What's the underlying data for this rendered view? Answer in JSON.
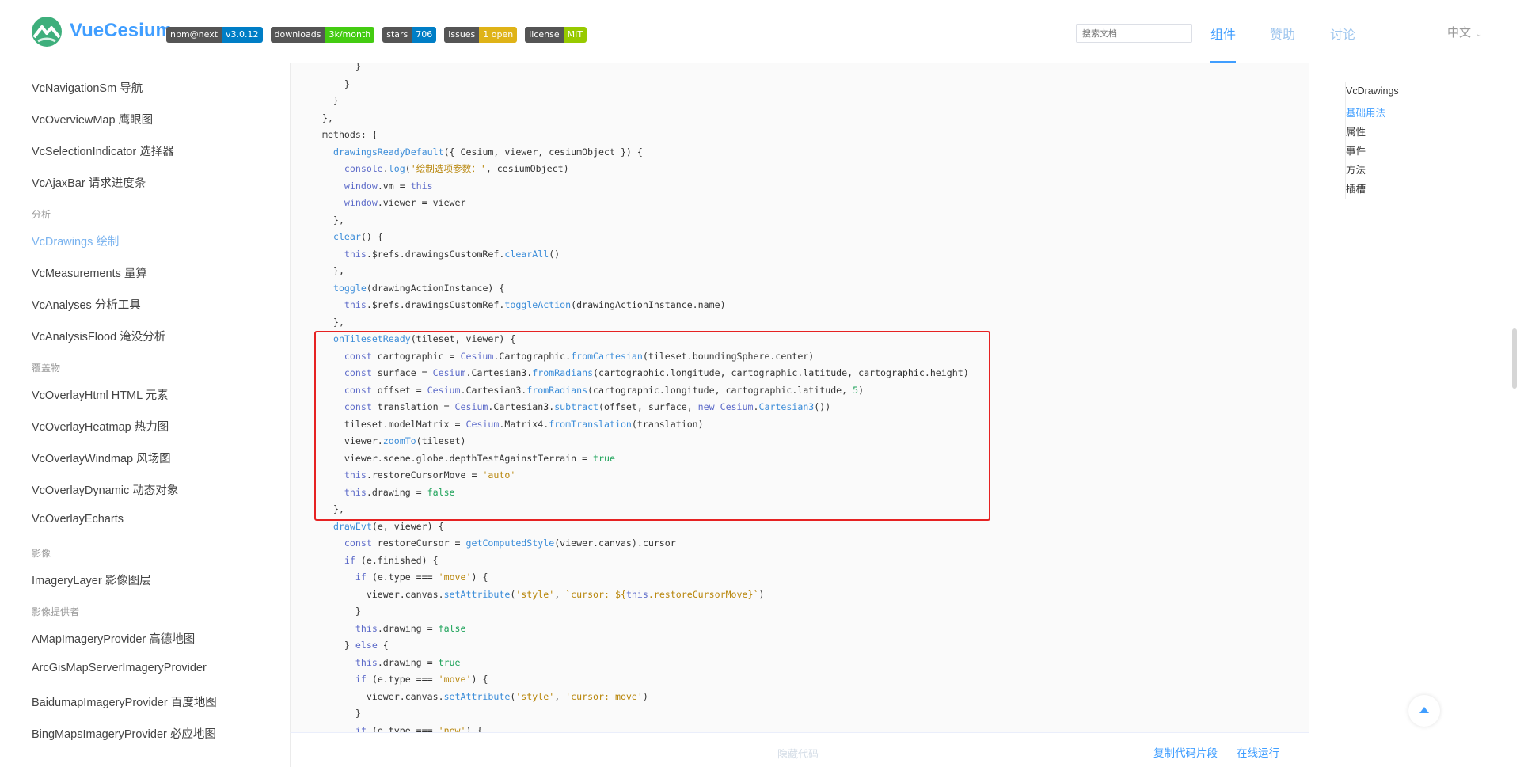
{
  "header": {
    "brand": "VueCesium",
    "badges": [
      {
        "key": "npm@next",
        "value": "v3.0.12",
        "color": "#007ec6"
      },
      {
        "key": "downloads",
        "value": "3k/month",
        "color": "#4c1"
      },
      {
        "key": "stars",
        "value": "706",
        "color": "#007ec6"
      },
      {
        "key": "issues",
        "value": "1 open",
        "color": "#dfb317"
      },
      {
        "key": "license",
        "value": "MIT",
        "color": "#97ca00"
      }
    ],
    "search_placeholder": "搜索文档",
    "nav": [
      "组件",
      "赞助",
      "讨论"
    ],
    "lang": "中文"
  },
  "sidebar": {
    "items": [
      {
        "label": "VcNavigationSm 导航",
        "type": "item"
      },
      {
        "label": "VcOverviewMap 鹰眼图",
        "type": "item"
      },
      {
        "label": "VcSelectionIndicator 选择器",
        "type": "item"
      },
      {
        "label": "VcAjaxBar 请求进度条",
        "type": "item"
      },
      {
        "label": "分析",
        "type": "group"
      },
      {
        "label": "VcDrawings 绘制",
        "type": "active"
      },
      {
        "label": "VcMeasurements 量算",
        "type": "item"
      },
      {
        "label": "VcAnalyses 分析工具",
        "type": "item"
      },
      {
        "label": "VcAnalysisFlood 淹没分析",
        "type": "item"
      },
      {
        "label": "覆盖物",
        "type": "group"
      },
      {
        "label": "VcOverlayHtml HTML 元素",
        "type": "item"
      },
      {
        "label": "VcOverlayHeatmap 热力图",
        "type": "item"
      },
      {
        "label": "VcOverlayWindmap 风场图",
        "type": "item"
      },
      {
        "label": "VcOverlayDynamic 动态对象",
        "type": "item"
      },
      {
        "label": "VcOverlayEcharts",
        "type": "item"
      },
      {
        "label": "影像",
        "type": "group"
      },
      {
        "label": "ImageryLayer 影像图层",
        "type": "item"
      },
      {
        "label": "影像提供者",
        "type": "group"
      },
      {
        "label": "AMapImageryProvider 高德地图",
        "type": "item"
      },
      {
        "label": "ArcGisMapServerImageryProvider",
        "type": "item"
      },
      {
        "label": "BaidumapImageryProvider 百度地图",
        "type": "item"
      },
      {
        "label": "BingMapsImageryProvider 必应地图",
        "type": "item"
      }
    ]
  },
  "code": [
    [
      [
        "t-plain",
        "      }"
      ]
    ],
    [
      [
        "t-plain",
        "    }"
      ]
    ],
    [
      [
        "t-plain",
        "  }"
      ]
    ],
    [
      [
        "t-plain",
        "},"
      ]
    ],
    [
      [
        "t-plain",
        "methods: {"
      ]
    ],
    [
      [
        "t-plain",
        "  "
      ],
      [
        "t-fn",
        "drawingsReadyDefault"
      ],
      [
        "t-plain",
        "({ Cesium, viewer, cesiumObject }) {"
      ]
    ],
    [
      [
        "t-plain",
        "    "
      ],
      [
        "t-kw",
        "console"
      ],
      [
        "t-plain",
        "."
      ],
      [
        "t-fn",
        "log"
      ],
      [
        "t-plain",
        "("
      ],
      [
        "t-str",
        "'绘制选项参数：'"
      ],
      [
        "t-plain",
        ", cesiumObject)"
      ]
    ],
    [
      [
        "t-plain",
        "    "
      ],
      [
        "t-kw",
        "window"
      ],
      [
        "t-plain",
        ".vm = "
      ],
      [
        "t-kw",
        "this"
      ]
    ],
    [
      [
        "t-plain",
        "    "
      ],
      [
        "t-kw",
        "window"
      ],
      [
        "t-plain",
        ".viewer = viewer"
      ]
    ],
    [
      [
        "t-plain",
        "  },"
      ]
    ],
    [
      [
        "t-plain",
        "  "
      ],
      [
        "t-fn",
        "clear"
      ],
      [
        "t-plain",
        "() {"
      ]
    ],
    [
      [
        "t-plain",
        "    "
      ],
      [
        "t-kw",
        "this"
      ],
      [
        "t-plain",
        ".$refs.drawingsCustomRef."
      ],
      [
        "t-fn",
        "clearAll"
      ],
      [
        "t-plain",
        "()"
      ]
    ],
    [
      [
        "t-plain",
        "  },"
      ]
    ],
    [
      [
        "t-plain",
        "  "
      ],
      [
        "t-fn",
        "toggle"
      ],
      [
        "t-plain",
        "(drawingActionInstance) {"
      ]
    ],
    [
      [
        "t-plain",
        "    "
      ],
      [
        "t-kw",
        "this"
      ],
      [
        "t-plain",
        ".$refs.drawingsCustomRef."
      ],
      [
        "t-fn",
        "toggleAction"
      ],
      [
        "t-plain",
        "(drawingActionInstance.name)"
      ]
    ],
    [
      [
        "t-plain",
        "  },"
      ]
    ],
    [
      [
        "t-plain",
        "  "
      ],
      [
        "t-fn",
        "onTilesetReady"
      ],
      [
        "t-plain",
        "(tileset, viewer) {"
      ]
    ],
    [
      [
        "t-plain",
        "    "
      ],
      [
        "t-kw",
        "const"
      ],
      [
        "t-plain",
        " cartographic = "
      ],
      [
        "t-kw",
        "Cesium"
      ],
      [
        "t-plain",
        ".Cartographic."
      ],
      [
        "t-fn",
        "fromCartesian"
      ],
      [
        "t-plain",
        "(tileset.boundingSphere.center)"
      ]
    ],
    [
      [
        "t-plain",
        "    "
      ],
      [
        "t-kw",
        "const"
      ],
      [
        "t-plain",
        " surface = "
      ],
      [
        "t-kw",
        "Cesium"
      ],
      [
        "t-plain",
        ".Cartesian3."
      ],
      [
        "t-fn",
        "fromRadians"
      ],
      [
        "t-plain",
        "(cartographic.longitude, cartographic.latitude, cartographic.height)"
      ]
    ],
    [
      [
        "t-plain",
        "    "
      ],
      [
        "t-kw",
        "const"
      ],
      [
        "t-plain",
        " offset = "
      ],
      [
        "t-kw",
        "Cesium"
      ],
      [
        "t-plain",
        ".Cartesian3."
      ],
      [
        "t-fn",
        "fromRadians"
      ],
      [
        "t-plain",
        "(cartographic.longitude, cartographic.latitude, "
      ],
      [
        "t-bool",
        "5"
      ],
      [
        "t-plain",
        ")"
      ]
    ],
    [
      [
        "t-plain",
        "    "
      ],
      [
        "t-kw",
        "const"
      ],
      [
        "t-plain",
        " translation = "
      ],
      [
        "t-kw",
        "Cesium"
      ],
      [
        "t-plain",
        ".Cartesian3."
      ],
      [
        "t-fn",
        "subtract"
      ],
      [
        "t-plain",
        "(offset, surface, "
      ],
      [
        "t-kw",
        "new"
      ],
      [
        "t-plain",
        " "
      ],
      [
        "t-kw",
        "Cesium"
      ],
      [
        "t-plain",
        "."
      ],
      [
        "t-fn",
        "Cartesian3"
      ],
      [
        "t-plain",
        "())"
      ]
    ],
    [
      [
        "t-plain",
        "    tileset.modelMatrix = "
      ],
      [
        "t-kw",
        "Cesium"
      ],
      [
        "t-plain",
        ".Matrix4."
      ],
      [
        "t-fn",
        "fromTranslation"
      ],
      [
        "t-plain",
        "(translation)"
      ]
    ],
    [
      [
        "t-plain",
        "    viewer."
      ],
      [
        "t-fn",
        "zoomTo"
      ],
      [
        "t-plain",
        "(tileset)"
      ]
    ],
    [
      [
        "t-plain",
        "    viewer.scene.globe.depthTestAgainstTerrain = "
      ],
      [
        "t-bool",
        "true"
      ]
    ],
    [
      [
        "t-plain",
        "    "
      ],
      [
        "t-kw",
        "this"
      ],
      [
        "t-plain",
        ".restoreCursorMove = "
      ],
      [
        "t-str",
        "'auto'"
      ]
    ],
    [
      [
        "t-plain",
        "    "
      ],
      [
        "t-kw",
        "this"
      ],
      [
        "t-plain",
        ".drawing = "
      ],
      [
        "t-bool",
        "false"
      ]
    ],
    [
      [
        "t-plain",
        "  },"
      ]
    ],
    [
      [
        "t-plain",
        "  "
      ],
      [
        "t-fn",
        "drawEvt"
      ],
      [
        "t-plain",
        "(e, viewer) {"
      ]
    ],
    [
      [
        "t-plain",
        "    "
      ],
      [
        "t-kw",
        "const"
      ],
      [
        "t-plain",
        " restoreCursor = "
      ],
      [
        "t-fn",
        "getComputedStyle"
      ],
      [
        "t-plain",
        "(viewer.canvas).cursor"
      ]
    ],
    [
      [
        "t-plain",
        "    "
      ],
      [
        "t-kw",
        "if"
      ],
      [
        "t-plain",
        " (e.finished) {"
      ]
    ],
    [
      [
        "t-plain",
        "      "
      ],
      [
        "t-kw",
        "if"
      ],
      [
        "t-plain",
        " (e.type === "
      ],
      [
        "t-str",
        "'move'"
      ],
      [
        "t-plain",
        ") {"
      ]
    ],
    [
      [
        "t-plain",
        "        viewer.canvas."
      ],
      [
        "t-fn",
        "setAttribute"
      ],
      [
        "t-plain",
        "("
      ],
      [
        "t-str",
        "'style'"
      ],
      [
        "t-plain",
        ", "
      ],
      [
        "t-str",
        "`cursor: ${"
      ],
      [
        "t-kw",
        "this"
      ],
      [
        "t-str",
        ".restoreCursorMove}`"
      ],
      [
        "t-plain",
        ")"
      ]
    ],
    [
      [
        "t-plain",
        "      }"
      ]
    ],
    [
      [
        "t-plain",
        "      "
      ],
      [
        "t-kw",
        "this"
      ],
      [
        "t-plain",
        ".drawing = "
      ],
      [
        "t-bool",
        "false"
      ]
    ],
    [
      [
        "t-plain",
        "    } "
      ],
      [
        "t-kw",
        "else"
      ],
      [
        "t-plain",
        " {"
      ]
    ],
    [
      [
        "t-plain",
        "      "
      ],
      [
        "t-kw",
        "this"
      ],
      [
        "t-plain",
        ".drawing = "
      ],
      [
        "t-bool",
        "true"
      ]
    ],
    [
      [
        "t-plain",
        "      "
      ],
      [
        "t-kw",
        "if"
      ],
      [
        "t-plain",
        " (e.type === "
      ],
      [
        "t-str",
        "'move'"
      ],
      [
        "t-plain",
        ") {"
      ]
    ],
    [
      [
        "t-plain",
        "        viewer.canvas."
      ],
      [
        "t-fn",
        "setAttribute"
      ],
      [
        "t-plain",
        "("
      ],
      [
        "t-str",
        "'style'"
      ],
      [
        "t-plain",
        ", "
      ],
      [
        "t-str",
        "'cursor: move'"
      ],
      [
        "t-plain",
        ")"
      ]
    ],
    [
      [
        "t-plain",
        "      }"
      ]
    ],
    [
      [
        "t-plain",
        "      "
      ],
      [
        "t-kw",
        "if"
      ],
      [
        "t-plain",
        " (e.type === "
      ],
      [
        "t-str",
        "'new'"
      ],
      [
        "t-plain",
        ") {"
      ]
    ]
  ],
  "controls": {
    "hide_code": "隐藏代码",
    "copy": "复制代码片段",
    "run": "在线运行"
  },
  "toc": {
    "items": [
      "VcDrawings",
      "基础用法",
      "属性",
      "事件",
      "方法",
      "插槽"
    ],
    "active_index": 1
  },
  "colors": {
    "accent": "#409eff",
    "highlight_border": "#e62222"
  }
}
